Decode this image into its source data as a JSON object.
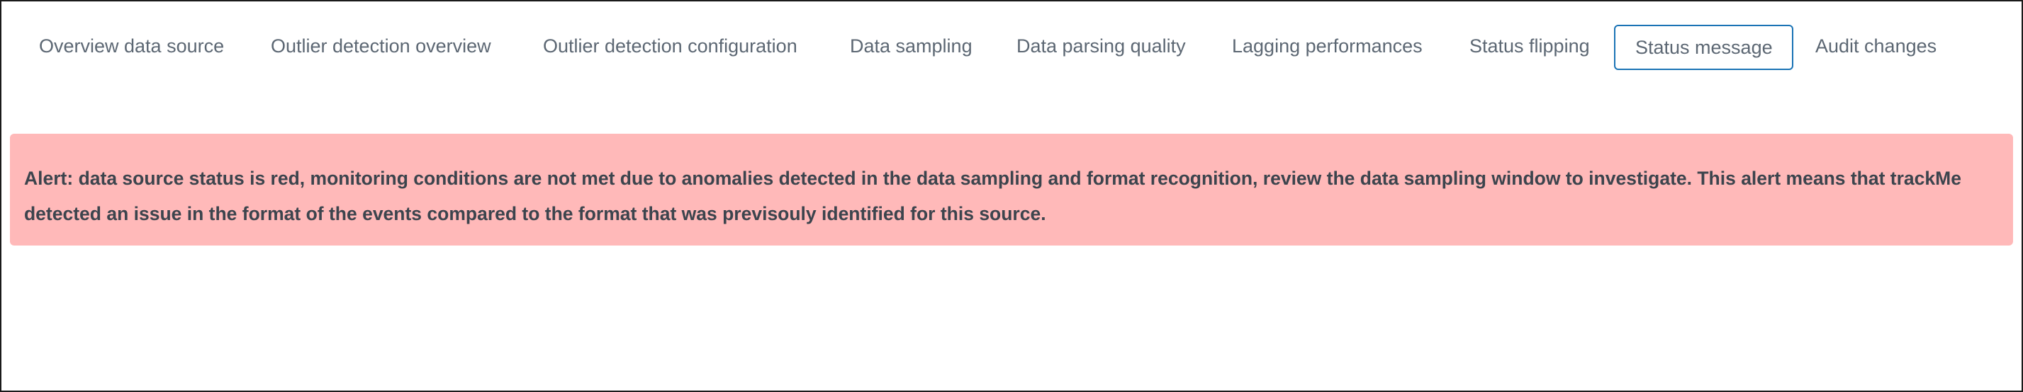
{
  "tabs": [
    {
      "label": "Overview data source",
      "active": false
    },
    {
      "label": "Outlier detection overview",
      "active": false
    },
    {
      "label": "Outlier detection configuration",
      "active": false
    },
    {
      "label": "Data sampling",
      "active": false
    },
    {
      "label": "Data parsing quality",
      "active": false
    },
    {
      "label": "Lagging performances",
      "active": false
    },
    {
      "label": "Status flipping",
      "active": false
    },
    {
      "label": "Status message",
      "active": true
    },
    {
      "label": "Audit changes",
      "active": false
    }
  ],
  "alert": {
    "message": "Alert: data source status is red, monitoring conditions are not met due to anomalies detected in the data sampling and format recognition, review the data sampling window to investigate. This alert means that trackMe detected an issue in the format of the events compared to the format that was previsouly identified for this source.",
    "background_color": "#ffb9b9"
  },
  "colors": {
    "active_tab_border": "#1a73b5",
    "tab_text": "#5c6773"
  }
}
